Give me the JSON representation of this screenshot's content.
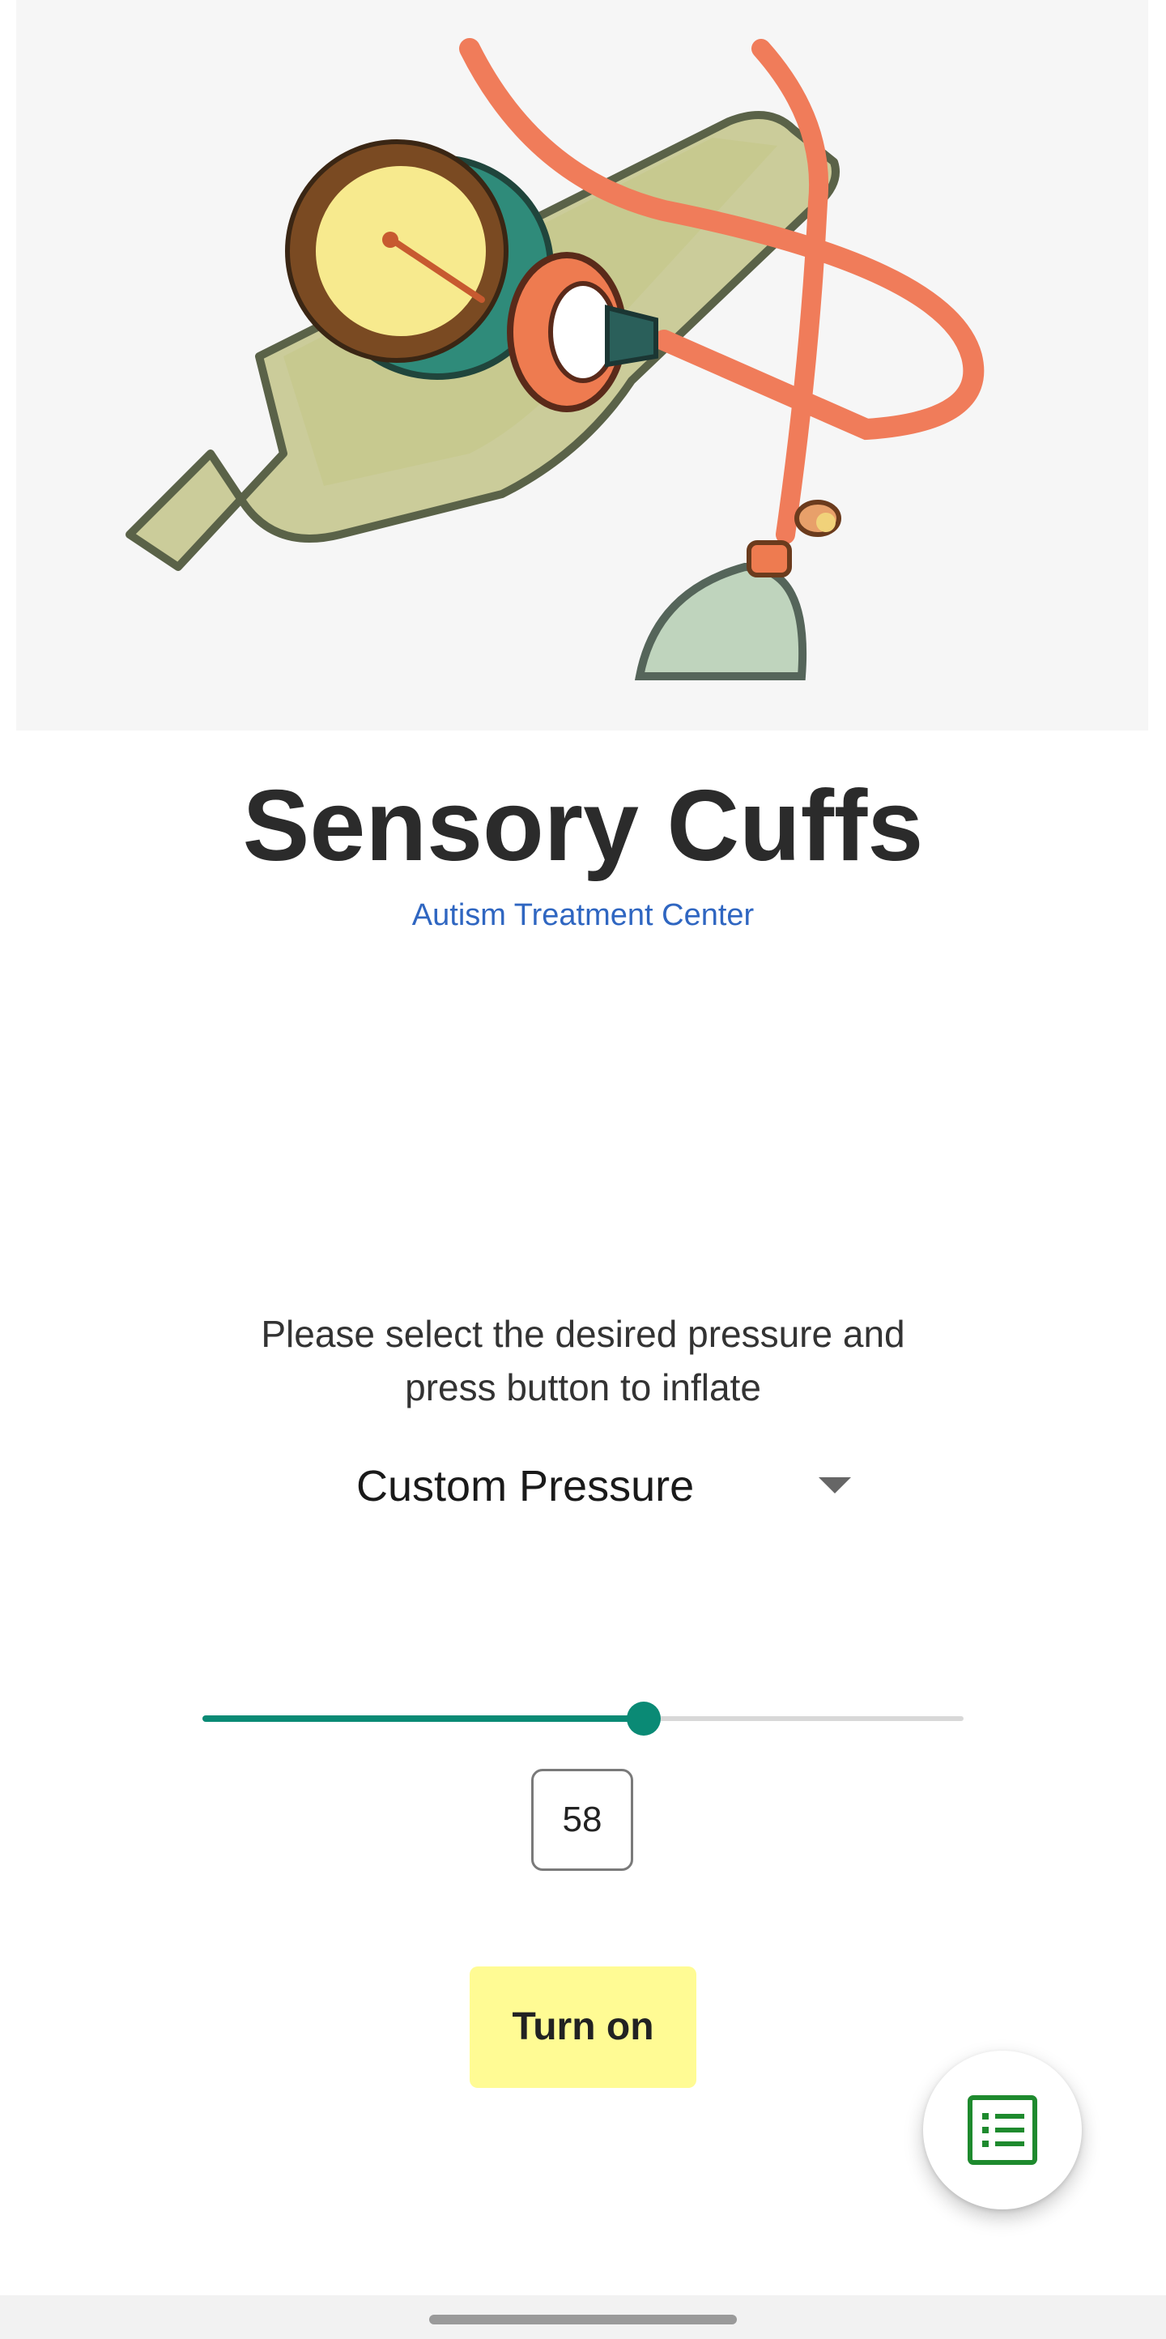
{
  "hero": {
    "image": "blood-pressure-cuff-illustration"
  },
  "header": {
    "title": "Sensory Cuffs",
    "subtitle": "Autism Treatment Center"
  },
  "main": {
    "instruction_line1": "Please select the desired pressure and",
    "instruction_line2": "press button to inflate",
    "dropdown": {
      "selected": "Custom Pressure",
      "icon": "triangle-down-icon"
    },
    "slider": {
      "value_fraction": 0.58,
      "fill_color": "#0a8a75",
      "track_color": "#d8d8d8"
    },
    "value_display": "58",
    "turn_on_label": "Turn on",
    "turn_on_color": "#fffb94"
  },
  "fab": {
    "icon": "list-icon",
    "icon_color": "#1e8a2e"
  }
}
